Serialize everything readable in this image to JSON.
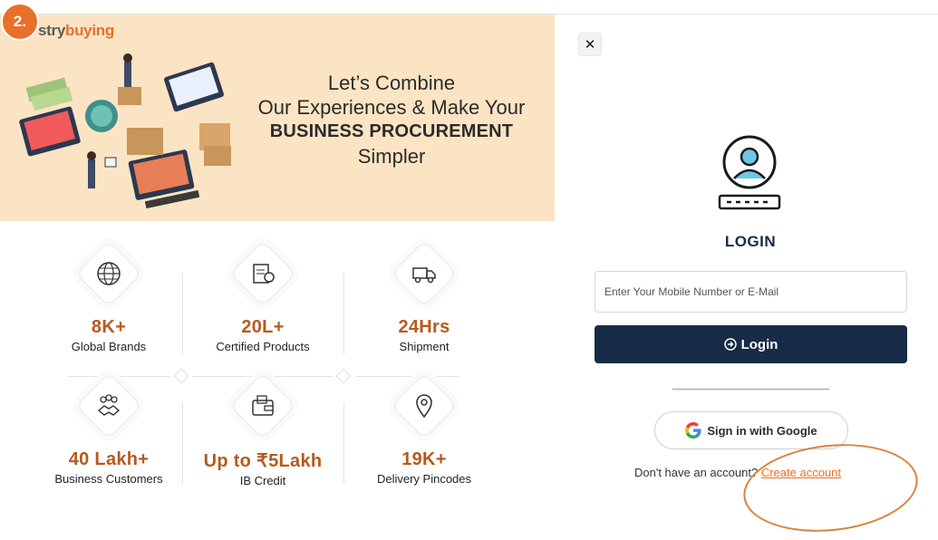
{
  "step_badge": "2.",
  "brand": {
    "part1": "stry",
    "part2": "buying"
  },
  "banner": {
    "line1": "Let’s Combine",
    "line2": "Our Experiences & Make Your",
    "line3": "BUSINESS PROCUREMENT",
    "line4": "Simpler"
  },
  "stats": [
    {
      "value": "8K+",
      "label": "Global Brands",
      "icon": "globe-icon"
    },
    {
      "value": "20L+",
      "label": "Certified Products",
      "icon": "certified-doc-icon"
    },
    {
      "value": "24Hrs",
      "label": "Shipment",
      "icon": "truck-icon"
    },
    {
      "value": "40 Lakh+",
      "label": "Business Customers",
      "icon": "handshake-icon"
    },
    {
      "value": "Up to ₹5Lakh",
      "label": "IB Credit",
      "icon": "wallet-icon"
    },
    {
      "value": "19K+",
      "label": "Delivery Pincodes",
      "icon": "location-pin-icon"
    }
  ],
  "login": {
    "close": "✕",
    "title": "LOGIN",
    "input_placeholder": "Enter Your Mobile Number or E-Mail",
    "input_value": "",
    "login_button": "Login",
    "google_button": "Sign in with Google",
    "no_account_text": "Don't have an account?",
    "create_account": "Create account"
  },
  "colors": {
    "accent": "#e8702a",
    "navy": "#172b47",
    "banner_bg": "#fbe4c3",
    "stat_value": "#b65a1e"
  }
}
